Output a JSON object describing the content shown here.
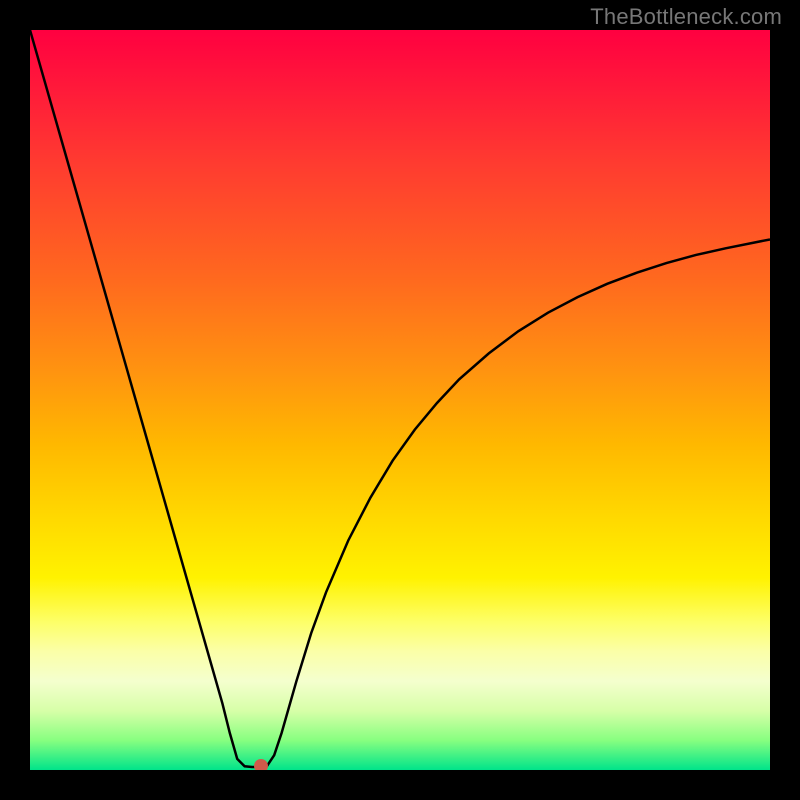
{
  "watermark": "TheBottleneck.com",
  "chart_data": {
    "type": "line",
    "title": "",
    "xlabel": "",
    "ylabel": "",
    "xlim": [
      0,
      100
    ],
    "ylim": [
      0,
      100
    ],
    "grid": false,
    "legend": false,
    "background_gradient": {
      "direction": "vertical",
      "stops": [
        {
          "pos": 0,
          "color": "#ff0040"
        },
        {
          "pos": 8,
          "color": "#ff1a3a"
        },
        {
          "pos": 18,
          "color": "#ff3b30"
        },
        {
          "pos": 34,
          "color": "#ff6a1e"
        },
        {
          "pos": 46,
          "color": "#ff9310"
        },
        {
          "pos": 56,
          "color": "#ffb800"
        },
        {
          "pos": 66,
          "color": "#ffd900"
        },
        {
          "pos": 74,
          "color": "#fff200"
        },
        {
          "pos": 80,
          "color": "#fdff68"
        },
        {
          "pos": 84,
          "color": "#fbffa8"
        },
        {
          "pos": 88,
          "color": "#f4ffce"
        },
        {
          "pos": 92,
          "color": "#d7ffa8"
        },
        {
          "pos": 96,
          "color": "#87ff80"
        },
        {
          "pos": 100,
          "color": "#00e48a"
        }
      ]
    },
    "curve": {
      "stroke": "#000000",
      "width": 2.5,
      "points": [
        {
          "x": 0,
          "y": 100
        },
        {
          "x": 2,
          "y": 93
        },
        {
          "x": 4,
          "y": 86
        },
        {
          "x": 6,
          "y": 79
        },
        {
          "x": 8,
          "y": 72
        },
        {
          "x": 10,
          "y": 65
        },
        {
          "x": 12,
          "y": 58
        },
        {
          "x": 14,
          "y": 51
        },
        {
          "x": 16,
          "y": 44
        },
        {
          "x": 18,
          "y": 37
        },
        {
          "x": 20,
          "y": 30
        },
        {
          "x": 22,
          "y": 23
        },
        {
          "x": 24,
          "y": 16
        },
        {
          "x": 26,
          "y": 9
        },
        {
          "x": 27,
          "y": 5
        },
        {
          "x": 28,
          "y": 1.5
        },
        {
          "x": 29,
          "y": 0.5
        },
        {
          "x": 30,
          "y": 0.4
        },
        {
          "x": 31,
          "y": 0.4
        },
        {
          "x": 32,
          "y": 0.5
        },
        {
          "x": 33,
          "y": 2
        },
        {
          "x": 34,
          "y": 5
        },
        {
          "x": 36,
          "y": 12
        },
        {
          "x": 38,
          "y": 18.5
        },
        {
          "x": 40,
          "y": 24
        },
        {
          "x": 43,
          "y": 31
        },
        {
          "x": 46,
          "y": 36.8
        },
        {
          "x": 49,
          "y": 41.8
        },
        {
          "x": 52,
          "y": 46
        },
        {
          "x": 55,
          "y": 49.6
        },
        {
          "x": 58,
          "y": 52.8
        },
        {
          "x": 62,
          "y": 56.3
        },
        {
          "x": 66,
          "y": 59.3
        },
        {
          "x": 70,
          "y": 61.8
        },
        {
          "x": 74,
          "y": 63.9
        },
        {
          "x": 78,
          "y": 65.7
        },
        {
          "x": 82,
          "y": 67.2
        },
        {
          "x": 86,
          "y": 68.5
        },
        {
          "x": 90,
          "y": 69.6
        },
        {
          "x": 94,
          "y": 70.5
        },
        {
          "x": 98,
          "y": 71.3
        },
        {
          "x": 100,
          "y": 71.7
        }
      ]
    },
    "marker": {
      "x": 31.2,
      "y": 0.5,
      "color": "#d05a4a",
      "size": 14
    }
  }
}
